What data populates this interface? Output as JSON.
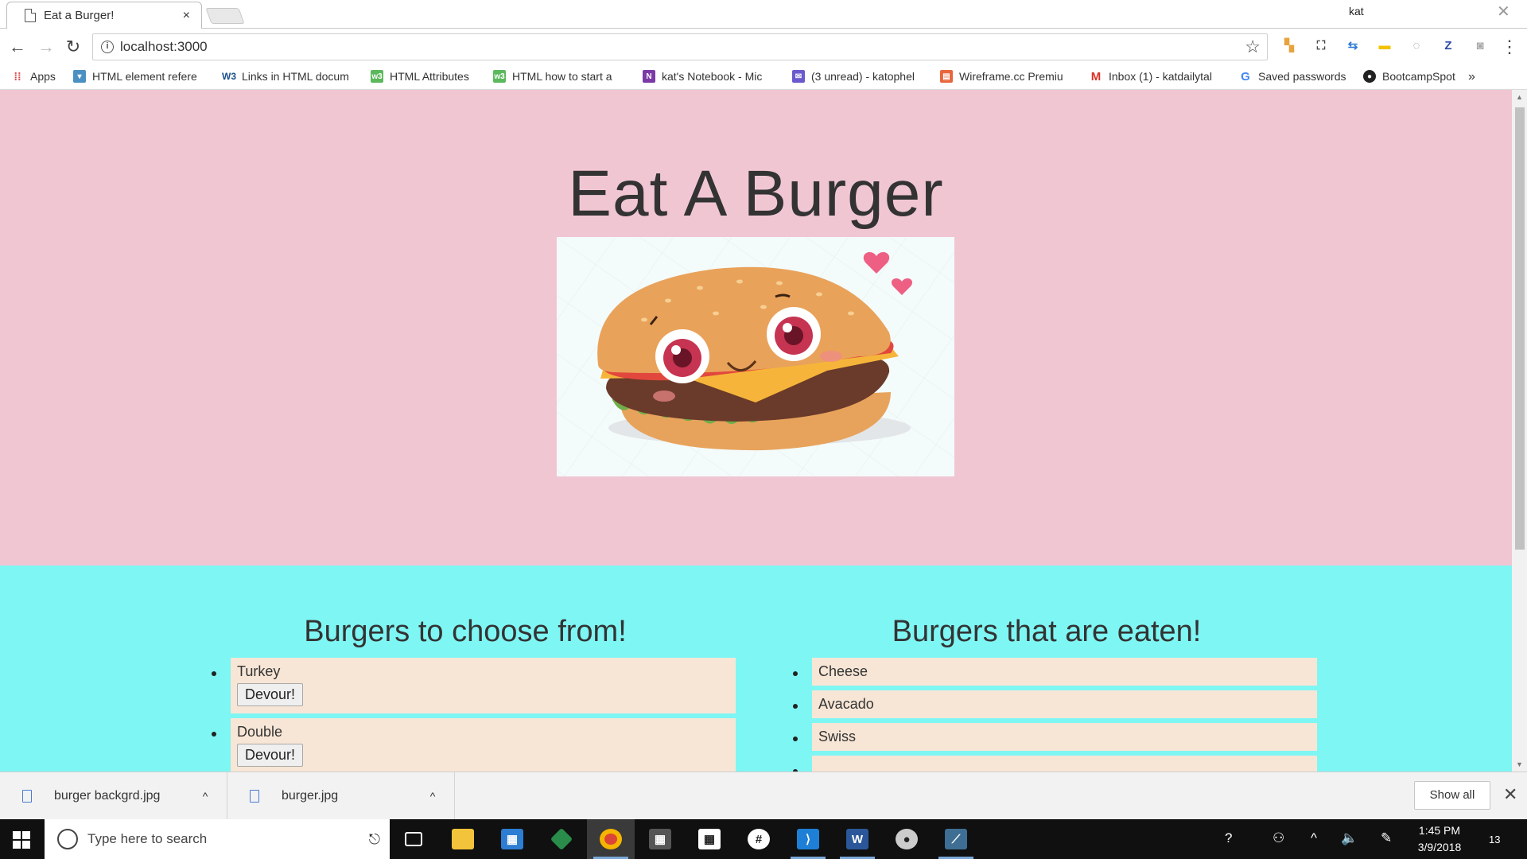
{
  "browser": {
    "tab_title": "Eat a Burger!",
    "tab_close": "×",
    "profile_name": "kat",
    "window_close": "✕",
    "back": "←",
    "forward": "→",
    "reload": "↻",
    "url": "localhost:3000",
    "star": "☆",
    "menu": "⋮",
    "extensions": [
      {
        "name": "extension-flag-icon",
        "glyph": "▚",
        "color": "#e8a33c"
      },
      {
        "name": "screenshot-icon",
        "glyph": "⛶",
        "color": "#444444"
      },
      {
        "name": "arrows-icon",
        "glyph": "⇆",
        "color": "#2e7bd6"
      },
      {
        "name": "extension-yellow-icon",
        "glyph": "▬",
        "color": "#f2c200"
      },
      {
        "name": "extension-circle-icon",
        "glyph": "◌",
        "color": "#888888"
      },
      {
        "name": "zotero-icon",
        "glyph": "Z",
        "color": "#2b4aa8"
      },
      {
        "name": "camera-icon",
        "glyph": "◙",
        "color": "#aaaaaa"
      }
    ],
    "bookmarks": [
      {
        "label": "Apps",
        "icon": "apps-grid-icon",
        "color": "#d44",
        "glyph": "⁞⁞"
      },
      {
        "label": "HTML element refere",
        "icon": "mdn-icon",
        "color": "#4a90c2",
        "glyph": "▾"
      },
      {
        "label": "Links in HTML docum",
        "icon": "w3c-icon",
        "color": "#1a4f8b",
        "glyph": "W3"
      },
      {
        "label": "HTML Attributes",
        "icon": "w3schools-icon",
        "color": "#5cb85c",
        "glyph": "w3"
      },
      {
        "label": "HTML how to start a",
        "icon": "w3schools-icon",
        "color": "#5cb85c",
        "glyph": "w3"
      },
      {
        "label": "kat's Notebook - Mic",
        "icon": "onenote-icon",
        "color": "#7b3aa6",
        "glyph": "N"
      },
      {
        "label": "(3 unread) - katophel",
        "icon": "mail-icon",
        "color": "#6a5acd",
        "glyph": "✉"
      },
      {
        "label": "Wireframe.cc Premiu",
        "icon": "wireframe-icon",
        "color": "#e8663c",
        "glyph": "▤"
      },
      {
        "label": "Inbox (1) - katdailytal",
        "icon": "gmail-icon",
        "color": "#d93025",
        "glyph": "M"
      },
      {
        "label": "Saved passwords",
        "icon": "google-icon",
        "color": "#4285f4",
        "glyph": "G"
      },
      {
        "label": "BootcampSpot",
        "icon": "github-icon",
        "color": "#222222",
        "glyph": "●"
      }
    ],
    "bookmarks_more": "»"
  },
  "page": {
    "title": "Eat A Burger",
    "left_heading": "Burgers to choose from!",
    "right_heading": "Burgers that are eaten!",
    "button_label": "Devour!",
    "to_eat": [
      {
        "name": "Turkey"
      },
      {
        "name": "Double"
      }
    ],
    "eaten": [
      {
        "name": "Cheese"
      },
      {
        "name": "Avacado"
      },
      {
        "name": "Swiss"
      },
      {
        "name": ""
      }
    ],
    "colors": {
      "hero_bg": "#f1c6d3",
      "lists_bg": "#7ef6f4",
      "item_bg": "#f7e6d6"
    }
  },
  "downloads": {
    "items": [
      {
        "name": "burger backgrd.jpg"
      },
      {
        "name": "burger.jpg"
      }
    ],
    "caret": "^",
    "show_all": "Show all",
    "close": "✕"
  },
  "taskbar": {
    "search_placeholder": "Type here to search",
    "mic": "🎙",
    "time": "1:45 PM",
    "date": "3/9/2018",
    "notification_count": "13"
  }
}
